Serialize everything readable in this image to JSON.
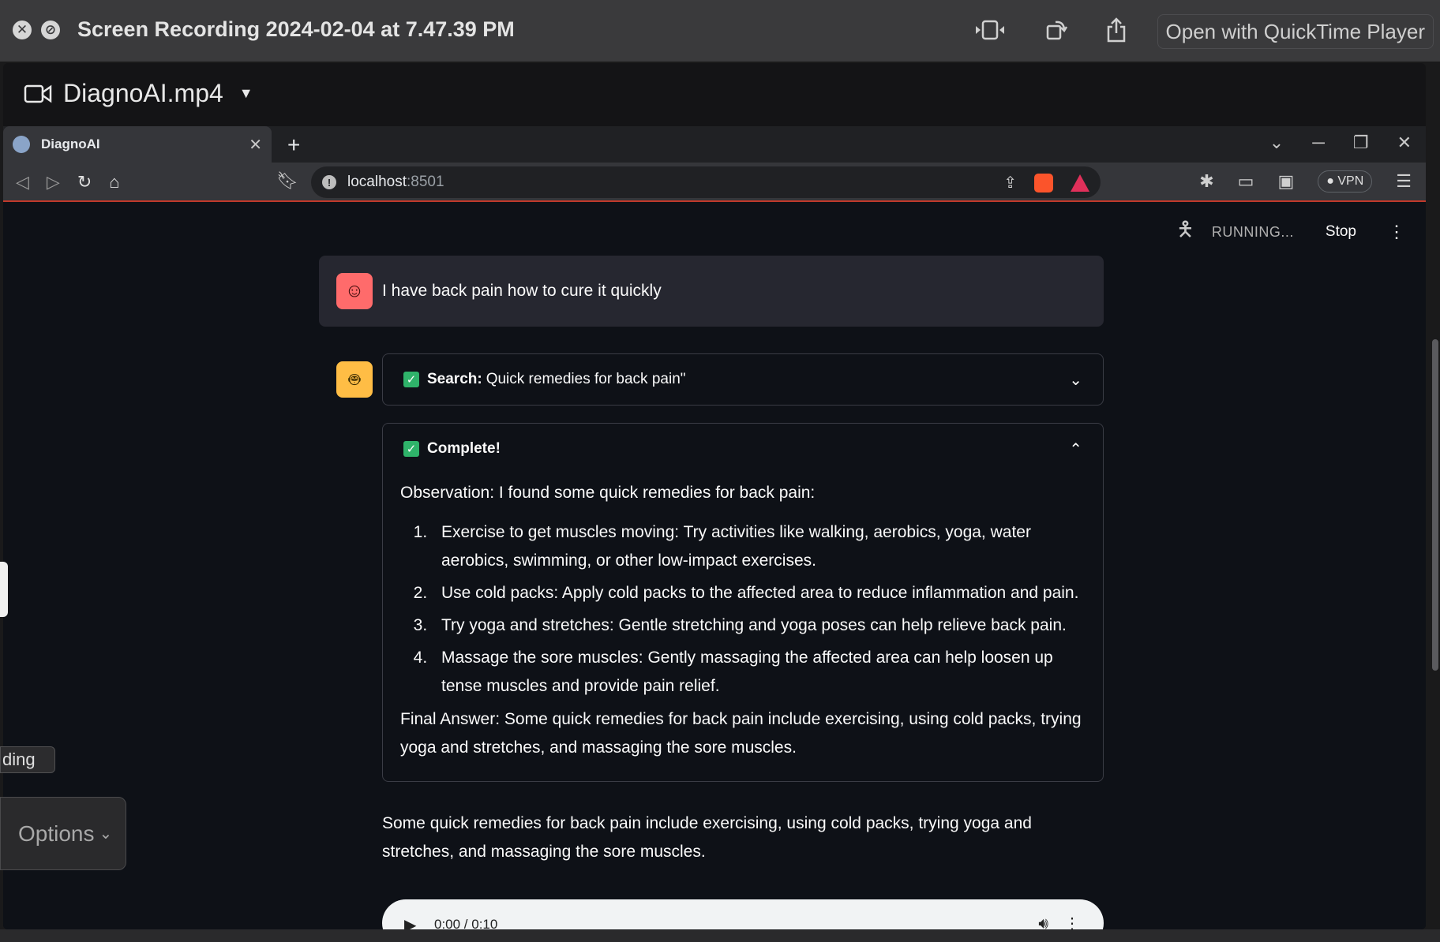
{
  "quicktime": {
    "title": "Screen Recording 2024-02-04 at 7.47.39 PM",
    "open_button": "Open with QuickTime Player",
    "file_name": "DiagnoAI.mp4",
    "chip_text": "ding",
    "options_label": "Options"
  },
  "browser": {
    "tab_title": "DiagnoAI",
    "url_host": "localhost",
    "url_port": ":8501",
    "vpn_label": "VPN"
  },
  "app": {
    "status": {
      "running": "RUNNING...",
      "stop": "Stop"
    },
    "user_message": "I have back pain how to cure it quickly",
    "search_expander": {
      "label": "Search:",
      "query": "Quick remedies for back pain\""
    },
    "complete_expander": {
      "label": "Complete!",
      "observation": "Observation: I found some quick remedies for back pain:",
      "items": [
        "Exercise to get muscles moving: Try activities like walking, aerobics, yoga, water aerobics, swimming, or other low-impact exercises.",
        "Use cold packs: Apply cold packs to the affected area to reduce inflammation and pain.",
        "Try yoga and stretches: Gentle stretching and yoga poses can help relieve back pain.",
        "Massage the sore muscles: Gently massaging the affected area can help loosen up tense muscles and provide pain relief."
      ],
      "final_answer": "Final Answer: Some quick remedies for back pain include exercising, using cold packs, trying yoga and stretches, and massaging the sore muscles."
    },
    "answer": "Some quick remedies for back pain include exercising, using cold packs, trying yoga and stretches, and massaging the sore muscles.",
    "audio_time": "0:00 / 0:10"
  },
  "colors": {
    "accent_green": "#2fb36a",
    "user_avatar": "#ff6b6b",
    "bot_avatar": "#ffbd45"
  }
}
